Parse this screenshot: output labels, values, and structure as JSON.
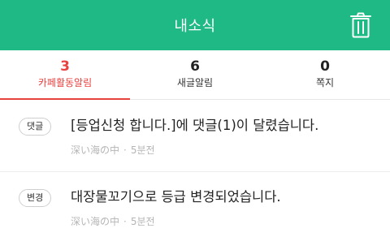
{
  "header": {
    "title": "내소식",
    "trash_icon": "trash-icon"
  },
  "colors": {
    "header_bg": "#1fb985",
    "active": "#e8423f"
  },
  "tabs": [
    {
      "count": "3",
      "label": "카페활동알림",
      "active": true
    },
    {
      "count": "6",
      "label": "새글알림",
      "active": false
    },
    {
      "count": "0",
      "label": "쪽지",
      "active": false
    }
  ],
  "notifications": [
    {
      "badge": "댓글",
      "message": "[등업신청 합니다.]에 댓글(1)이 달렸습니다.",
      "author": "深い海の中",
      "time": "5분전"
    },
    {
      "badge": "변경",
      "message": "대장물꼬기으로 등급 변경되었습니다.",
      "author": "深い海の中",
      "time": "5분전"
    }
  ]
}
